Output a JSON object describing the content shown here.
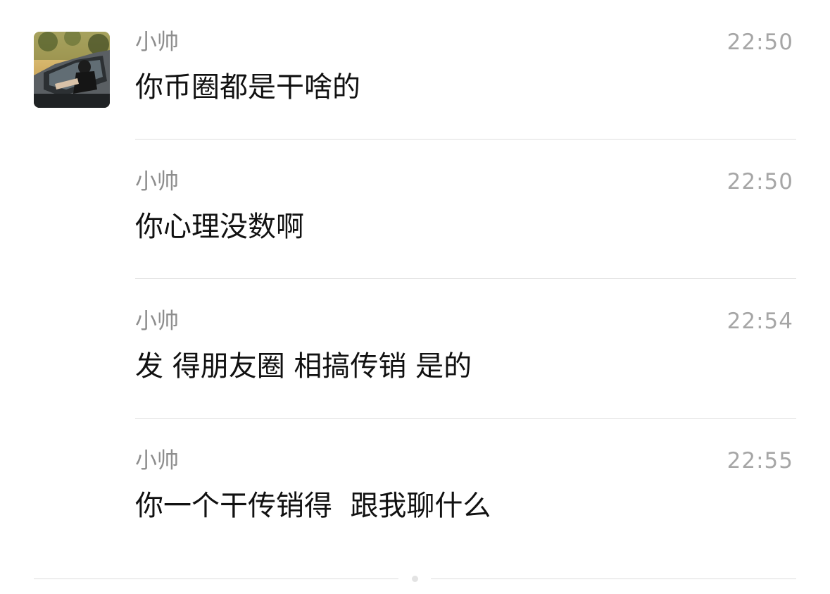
{
  "messages": [
    {
      "sender": "小帅",
      "time": "22:50",
      "text": "你币圈都是干啥的"
    },
    {
      "sender": "小帅",
      "time": "22:50",
      "text": "你心理没数啊"
    },
    {
      "sender": "小帅",
      "time": "22:54",
      "text": "发 得朋友圈 相搞传销 是的"
    },
    {
      "sender": "小帅",
      "time": "22:55",
      "text": "你一个干传销得  跟我聊什么"
    }
  ]
}
